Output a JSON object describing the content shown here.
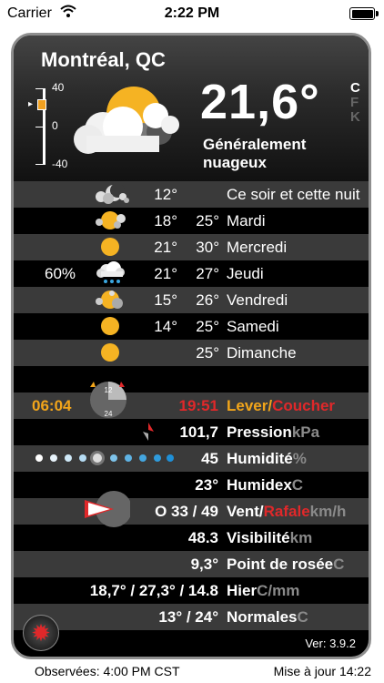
{
  "status_bar": {
    "carrier": "Carrier",
    "time": "2:22 PM",
    "battery_level": 1.0
  },
  "location": {
    "city": "Montréal, QC"
  },
  "current": {
    "temperature": "21,6°",
    "condition": "Généralement nuageux",
    "unit_options": [
      "C",
      "F",
      "K"
    ],
    "selected_unit": "C",
    "icon": "partly-cloudy-sun-icon"
  },
  "gauge": {
    "labels": [
      "40",
      "0",
      "-40"
    ]
  },
  "forecast": [
    {
      "precip": "",
      "low": "12°",
      "high": "",
      "label": "Ce soir et cette nuit",
      "icon": "moon-cloud-icon"
    },
    {
      "precip": "",
      "low": "18°",
      "high": "25°",
      "label": "Mardi",
      "icon": "sun-cloud-icon"
    },
    {
      "precip": "",
      "low": "21°",
      "high": "30°",
      "label": "Mercredi",
      "icon": "sun-icon"
    },
    {
      "precip": "60%",
      "low": "21°",
      "high": "27°",
      "label": "Jeudi",
      "icon": "rain-cloud-icon"
    },
    {
      "precip": "",
      "low": "15°",
      "high": "26°",
      "label": "Vendredi",
      "icon": "sun-cloud-icon"
    },
    {
      "precip": "",
      "low": "14°",
      "high": "25°",
      "label": "Samedi",
      "icon": "sun-icon"
    },
    {
      "precip": "",
      "low": "",
      "high": "25°",
      "label": "Dimanche",
      "icon": "sun-icon"
    }
  ],
  "sun": {
    "sunrise": "06:04",
    "sunset": "19:51",
    "label_lever": "Lever/",
    "label_coucher": "Coucher",
    "dial_top": "12",
    "dial_bottom": "24"
  },
  "details": {
    "pressure": {
      "value": "101,7",
      "label": "Pression",
      "unit": "kPa",
      "icon": "pressure-trend-icon"
    },
    "humidity": {
      "value": "45",
      "label": "Humidité",
      "unit": "%",
      "fraction": 0.45,
      "icon": "humidity-dots-icon"
    },
    "humidex": {
      "value": "23°",
      "label": "Humidex",
      "unit": "C"
    },
    "wind": {
      "value": "O 33 / 49",
      "label_vent": "Vent/",
      "label_rafale": "Rafale",
      "unit": "km/h",
      "icon": "wind-direction-icon"
    },
    "visibility": {
      "value": "48.3",
      "label": "Visibilité",
      "unit": "km"
    },
    "dewpoint": {
      "value": "9,3°",
      "label": "Point de rosée",
      "unit": "C"
    },
    "yesterday": {
      "value": "18,7° / 27,3° / 14.8",
      "label": "Hier",
      "unit": "C/mm"
    },
    "normals": {
      "value": "13° / 24°",
      "label": "Normales",
      "unit": "C"
    }
  },
  "app": {
    "version": "Ver: 3.9.2"
  },
  "footer": {
    "observed": "Observées: 4:00 PM CST",
    "updated": "Mise à jour 14:22"
  },
  "colors": {
    "sunset_red": "#e0282a",
    "sunrise_orange": "#f2a51a",
    "sun_yellow": "#f5b323",
    "unit_gray": "#8a8a8a"
  }
}
